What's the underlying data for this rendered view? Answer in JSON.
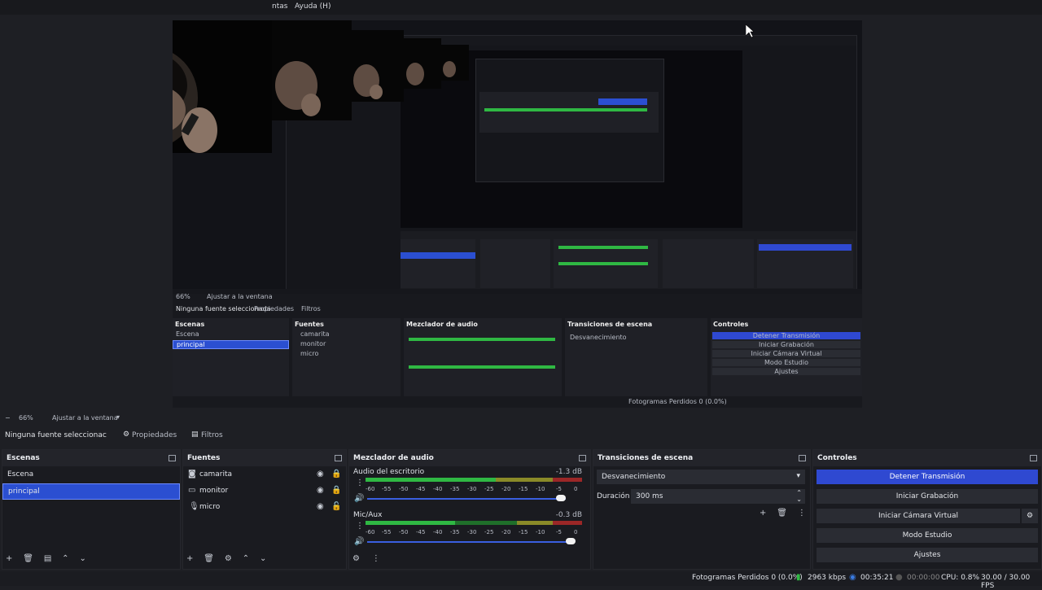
{
  "menu": [
    "ntas",
    "Ayuda (H)"
  ],
  "preview": {
    "title": "preview-capture",
    "status": "Ninguna fuente seleccionada",
    "tabs": [
      "Propiedades",
      "Filtros"
    ],
    "zoom": "66%",
    "fit": "Ajustar a la ventana"
  },
  "toolbar": {
    "zoom": "66%",
    "fit_label": "Ajustar a la ventana",
    "no_source": "Ninguna fuente seleccionac",
    "properties": "Propiedades",
    "filters": "Filtros"
  },
  "scenes": {
    "title": "Escenas",
    "items": [
      "Escena",
      "principal"
    ]
  },
  "sources": {
    "title": "Fuentes",
    "items": [
      {
        "name": "camarita",
        "icon": "camera-icon"
      },
      {
        "name": "monitor",
        "icon": "monitor-icon"
      },
      {
        "name": "micro",
        "icon": "mic-icon"
      }
    ]
  },
  "mixer": {
    "title": "Mezclador de audio",
    "channels": [
      {
        "name": "Audio del escritorio",
        "db": "-1.3 dB",
        "volume_pct": 95
      },
      {
        "name": "Mic/Aux",
        "db": "-0.3 dB",
        "volume_pct": 97
      }
    ],
    "scale": [
      "-60",
      "-55",
      "-50",
      "-45",
      "-40",
      "-35",
      "-30",
      "-25",
      "-20",
      "-15",
      "-10",
      "-5",
      "0"
    ]
  },
  "transitions": {
    "title": "Transiciones de escena",
    "selected": "Desvanecimiento",
    "duration_label": "Duración",
    "duration_value": "300 ms"
  },
  "controls": {
    "title": "Controles",
    "buttons": [
      "Detener Transmisión",
      "Iniciar Grabación",
      "Iniciar Cámara Virtual",
      "Modo Estudio",
      "Ajustes"
    ]
  },
  "status": {
    "dropped": "Fotogramas Perdidos 0 (0.0%)",
    "bitrate": "2963 kbps",
    "stream_time": "00:35:21",
    "rec_time": "00:00:00",
    "cpu": "CPU: 0.8%",
    "fps": "30.00 / 30.00 FPS"
  },
  "colors": {
    "accent": "#2f49d1",
    "background": "#1e1f24"
  }
}
